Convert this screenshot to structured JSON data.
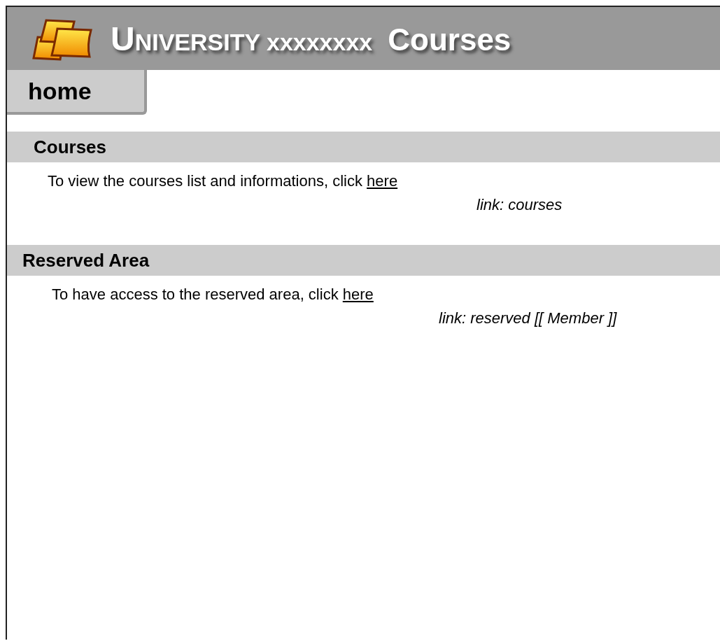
{
  "header": {
    "title_main": "UNIVERSITY xxxxxxxx",
    "title_rest": "Courses"
  },
  "tabs": [
    {
      "label": "home",
      "selected": true
    }
  ],
  "sections": [
    {
      "heading": "Courses",
      "text": "To view the courses list and informations, click ",
      "link": "here",
      "note": "link: courses"
    },
    {
      "heading": "Reserved Area",
      "text": "To have access to the reserved area, click ",
      "link": "here",
      "note": "link: reserved [[ Member ]]"
    }
  ]
}
